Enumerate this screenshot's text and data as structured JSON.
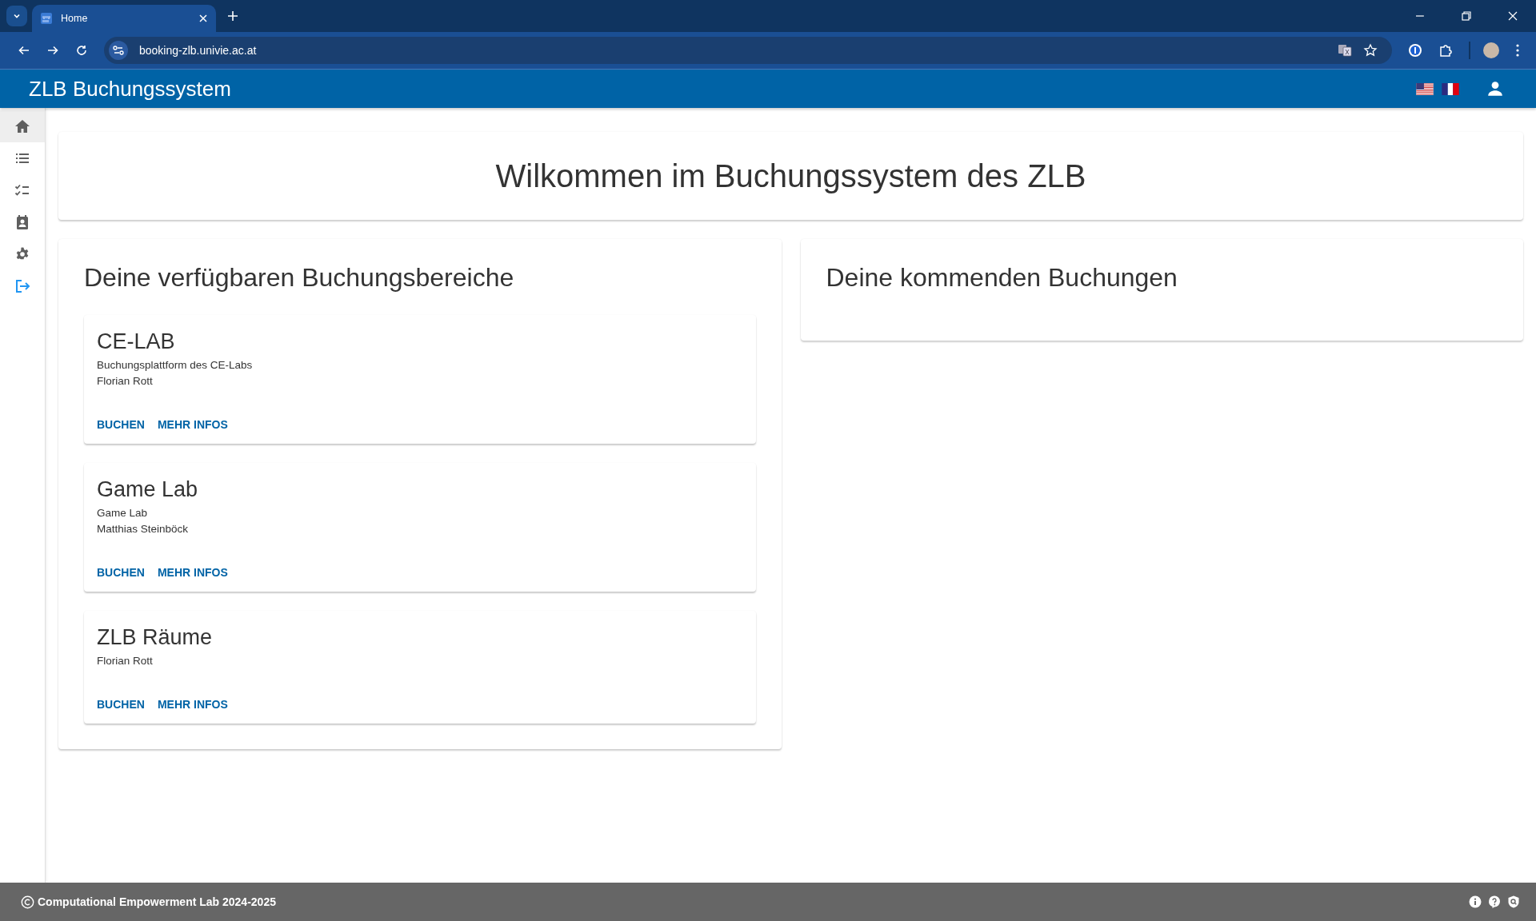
{
  "browser": {
    "tabs": [
      {
        "title": "Home",
        "selected": true
      }
    ],
    "url": "booking-zlb.univie.ac.at"
  },
  "header": {
    "title": "ZLB Buchungssystem"
  },
  "sidebar": {
    "items": [
      {
        "kind": "home",
        "selected": true
      },
      {
        "kind": "list",
        "selected": false
      },
      {
        "kind": "checklist",
        "selected": false
      },
      {
        "kind": "contact",
        "selected": false
      },
      {
        "kind": "settings",
        "selected": false
      },
      {
        "kind": "logout",
        "selected": false
      }
    ]
  },
  "welcome": {
    "title": "Wilkommen im Buchungssystem des ZLB"
  },
  "areas": {
    "title": "Deine verfügbaren Buchungsbereiche",
    "cards": [
      {
        "title": "CE-LAB",
        "lines": [
          "Buchungsplattform des CE-Labs",
          "Florian Rott"
        ],
        "actions": [
          "BUCHEN",
          "MEHR INFOS"
        ]
      },
      {
        "title": "Game Lab",
        "lines": [
          "Game Lab",
          "Matthias Steinböck"
        ],
        "actions": [
          "BUCHEN",
          "MEHR INFOS"
        ]
      },
      {
        "title": "ZLB Räume",
        "lines": [
          "Florian Rott"
        ],
        "actions": [
          "BUCHEN",
          "MEHR INFOS"
        ]
      }
    ]
  },
  "upcoming": {
    "title": "Deine kommenden Buchungen"
  },
  "footer": {
    "text": "Computational Empowerment Lab 2024-2025"
  }
}
